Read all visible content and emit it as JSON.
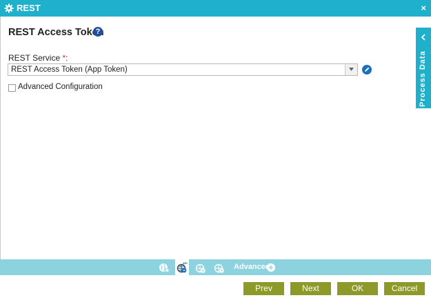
{
  "window": {
    "title": "REST",
    "close_glyph": "×",
    "icon": "gear-icon"
  },
  "heading": "REST Access Token",
  "help_glyph": "?",
  "service": {
    "label": "REST Service",
    "required_marker": "*",
    "colon": ":",
    "selected_value": "REST Access Token (App Token)"
  },
  "advanced_config": {
    "label": "Advanced Configuration",
    "checked": false
  },
  "process_data_tab": {
    "label": "Process Data"
  },
  "bottom_bar": {
    "advanced_label": "Advanced",
    "plus_glyph": "+",
    "icons": [
      "globe-gear-icon",
      "rest-web-icon",
      "rest-web-settings-icon",
      "rest-web-timer-icon"
    ]
  },
  "buttons": {
    "prev": "Prev",
    "next": "Next",
    "ok": "OK",
    "cancel": "Cancel"
  },
  "colors": {
    "title_bar": "#1fb1cb",
    "bottom_bar": "#8dd3df",
    "button": "#8d9a2a",
    "help_icon": "#1f4f9c",
    "required": "#e0262b"
  }
}
